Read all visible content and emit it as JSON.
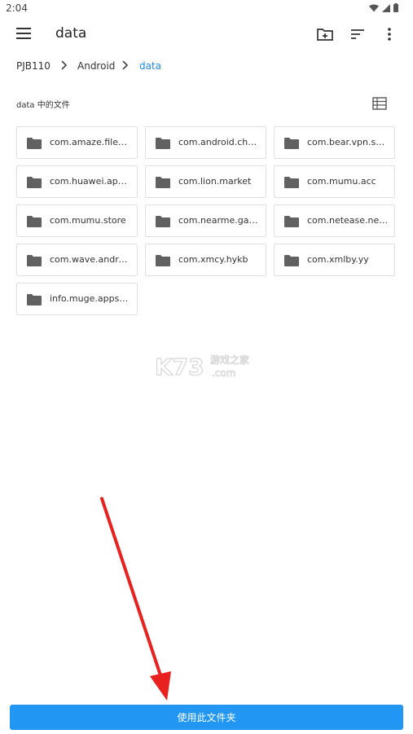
{
  "status": {
    "time": "2:04"
  },
  "toolbar": {
    "title": "data"
  },
  "breadcrumb": [
    "PJB110",
    "Android",
    "data"
  ],
  "section": {
    "title": "data 中的文件"
  },
  "folders": [
    "com.amaze.filem…",
    "com.android.chr…",
    "com.bear.vpn.su…",
    "com.huawei.app…",
    "com.lion.market",
    "com.mumu.acc",
    "com.mumu.store",
    "com.nearme.gam…",
    "com.netease.ne…",
    "com.wave.androi…",
    "com.xmcy.hykb",
    "com.xmlby.yy",
    "info.muge.appsh…"
  ],
  "watermark": {
    "text": "K73",
    "sub": "游戏之家",
    "domain": ".com"
  },
  "bottom_button": "使用此文件夹",
  "colors": {
    "accent": "#2196f3",
    "link": "#1e88e5",
    "icon": "#616161",
    "arrow": "#e8201e"
  }
}
